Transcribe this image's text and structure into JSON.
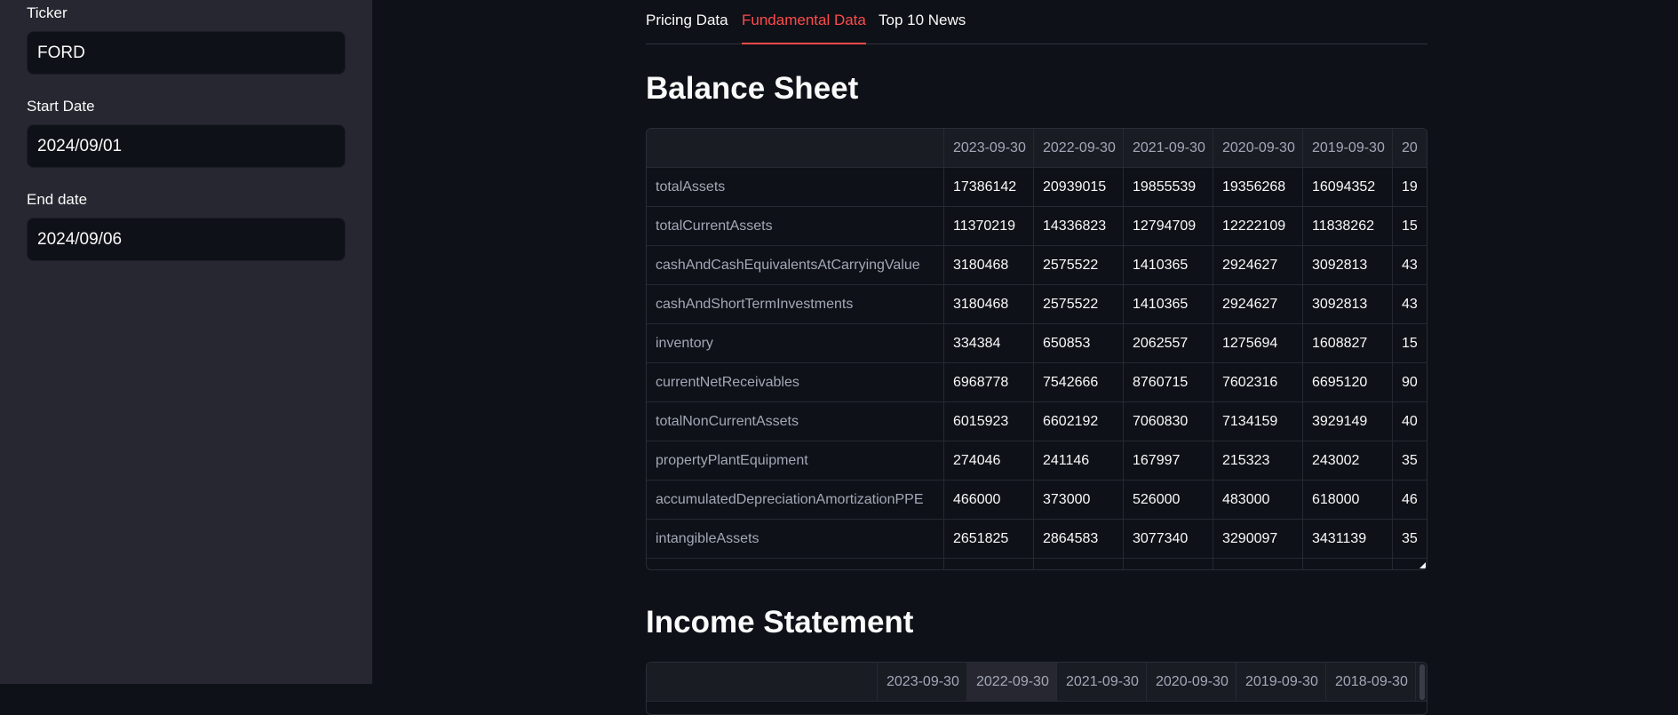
{
  "sidebar": {
    "ticker": {
      "label": "Ticker",
      "value": "FORD"
    },
    "start_date": {
      "label": "Start Date",
      "value": "2024/09/01"
    },
    "end_date": {
      "label": "End date",
      "value": "2024/09/06"
    }
  },
  "tabs": [
    {
      "label": "Pricing Data"
    },
    {
      "label": "Fundamental Data",
      "active": true
    },
    {
      "label": "Top 10 News"
    }
  ],
  "balance_sheet": {
    "title": "Balance Sheet",
    "columns": [
      "",
      "2023-09-30",
      "2022-09-30",
      "2021-09-30",
      "2020-09-30",
      "2019-09-30",
      "20"
    ],
    "rows": [
      [
        "totalAssets",
        "17386142",
        "20939015",
        "19855539",
        "19356268",
        "16094352",
        "19"
      ],
      [
        "totalCurrentAssets",
        "11370219",
        "14336823",
        "12794709",
        "12222109",
        "11838262",
        "15"
      ],
      [
        "cashAndCashEquivalentsAtCarryingValue",
        "3180468",
        "2575522",
        "1410365",
        "2924627",
        "3092813",
        "43"
      ],
      [
        "cashAndShortTermInvestments",
        "3180468",
        "2575522",
        "1410365",
        "2924627",
        "3092813",
        "43"
      ],
      [
        "inventory",
        "334384",
        "650853",
        "2062557",
        "1275694",
        "1608827",
        "15"
      ],
      [
        "currentNetReceivables",
        "6968778",
        "7542666",
        "8760715",
        "7602316",
        "6695120",
        "90"
      ],
      [
        "totalNonCurrentAssets",
        "6015923",
        "6602192",
        "7060830",
        "7134159",
        "3929149",
        "40"
      ],
      [
        "propertyPlantEquipment",
        "274046",
        "241146",
        "167997",
        "215323",
        "243002",
        "35"
      ],
      [
        "accumulatedDepreciationAmortizationPPE",
        "466000",
        "373000",
        "526000",
        "483000",
        "618000",
        "46"
      ],
      [
        "intangibleAssets",
        "2651825",
        "2864583",
        "3077340",
        "3290097",
        "3431139",
        "35"
      ],
      [
        "",
        "",
        "",
        "",
        "",
        "",
        ""
      ]
    ]
  },
  "income_statement": {
    "title": "Income Statement",
    "columns": [
      "",
      "2023-09-30",
      "2022-09-30",
      "2021-09-30",
      "2020-09-30",
      "2019-09-30",
      "2018-09-30"
    ]
  },
  "colors": {
    "accent": "#ff4b4b",
    "sidebar_bg": "#262730",
    "main_bg": "#0e1117"
  }
}
